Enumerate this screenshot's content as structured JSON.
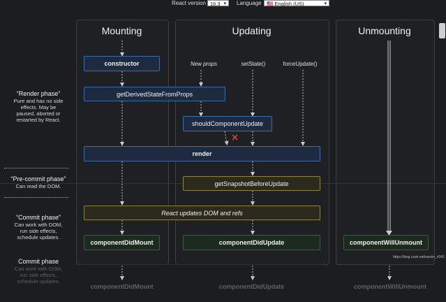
{
  "header": {
    "version_label": "React version",
    "version_value": "16.3",
    "language_label": "Language",
    "language_value": "English (US)",
    "language_flag": "🇺🇸"
  },
  "columns": {
    "mounting": "Mounting",
    "updating": "Updating",
    "unmounting": "Unmounting"
  },
  "phases": {
    "render": {
      "title": "“Render phase”",
      "desc": [
        "Pure and has no side",
        "effects. May be",
        "paused, aborted or",
        "restarted by React."
      ]
    },
    "precommit": {
      "title": "“Pre-commit phase”",
      "desc": [
        "Can read the DOM."
      ]
    },
    "commit": {
      "title": "“Commit phase”",
      "desc": [
        "Can work with DOM,",
        "run side effects,",
        "schedule updates."
      ]
    },
    "commit_ghost": {
      "title": "Commit phase",
      "desc": [
        "Can work with DOM,",
        "run side effects,",
        "schedule updates."
      ]
    }
  },
  "triggers": {
    "new_props": "New props",
    "set_state": "setState()",
    "force_update": "forceUpdate()"
  },
  "methods": {
    "constructor": "constructor",
    "get_derived": "getDerivedStateFromProps",
    "should_update": "shouldComponentUpdate",
    "render": "render",
    "get_snapshot": "getSnapshotBeforeUpdate",
    "dom_update": "React updates DOM and refs",
    "did_mount": "componentDidMount",
    "did_update": "componentDidUpdate",
    "will_unmount": "componentWillUnmount"
  },
  "ghost_row": {
    "did_mount": "componentDidMount",
    "did_update": "componentDidUpdate",
    "will_unmount": "componentWillUnmount"
  },
  "watermark": "https://blog.csdn.net/weixin_4​3​4​1​",
  "colors": {
    "background": "#1c1d1f",
    "render_box": "#3e6ca6",
    "precommit_box": "#8c8446",
    "commit_box": "#3d5c45",
    "cancel_mark": "#e53935"
  }
}
